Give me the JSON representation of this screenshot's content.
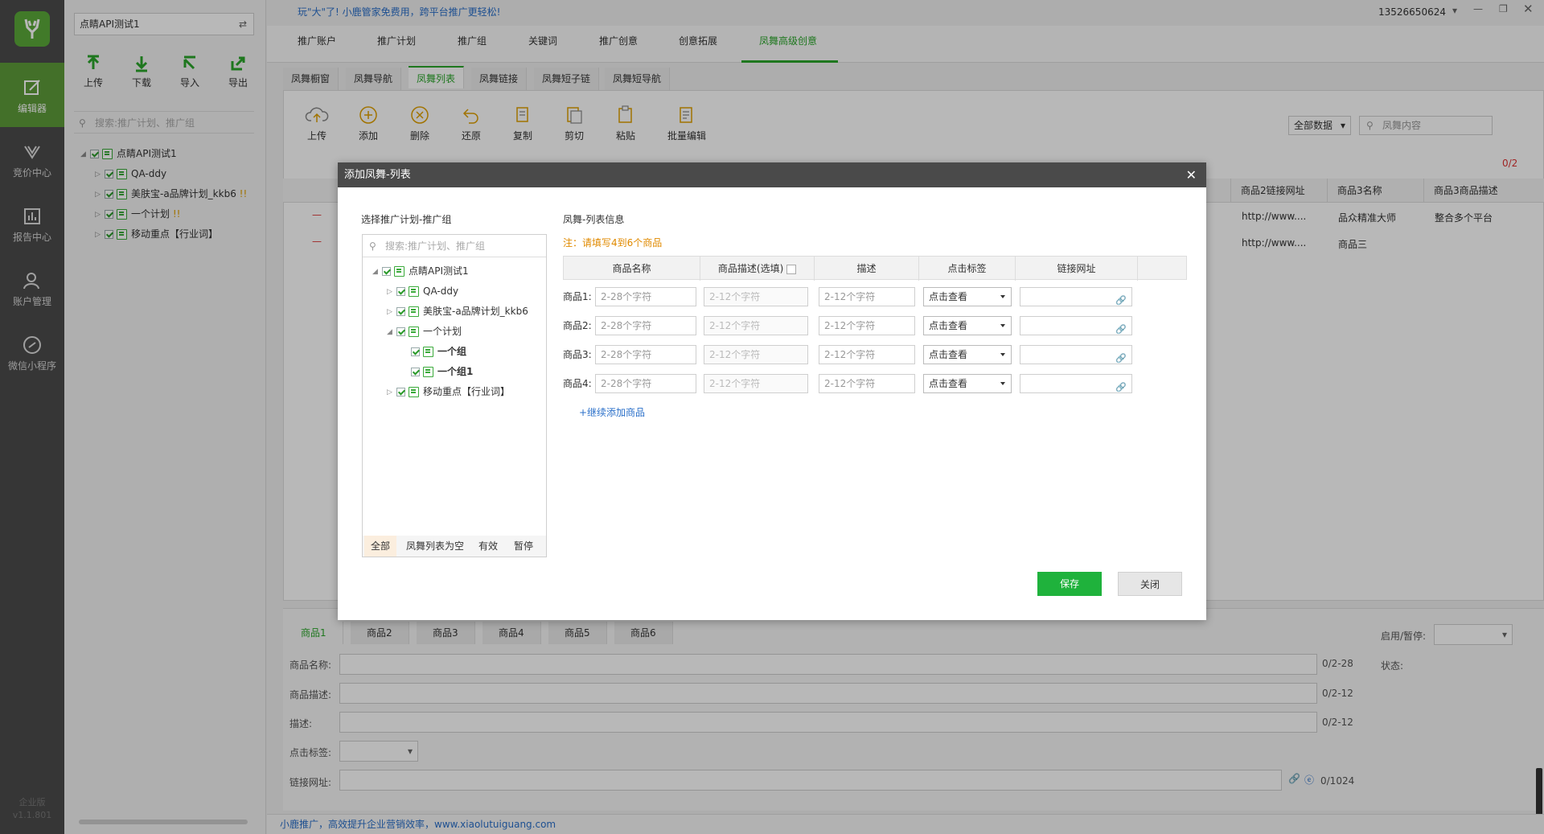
{
  "app": {
    "logo_text": "",
    "edition": "企业版",
    "version": "v1.1.801",
    "user": "13526650624"
  },
  "left_nav": [
    {
      "label": "编辑器",
      "icon": "edit-icon",
      "active": true
    },
    {
      "label": "竞价中心",
      "icon": "bid-icon"
    },
    {
      "label": "报告中心",
      "icon": "report-icon"
    },
    {
      "label": "账户管理",
      "icon": "user-icon"
    },
    {
      "label": "微信小程序",
      "icon": "mini-program-icon"
    }
  ],
  "panel": {
    "account_select": "点睛API测试1",
    "toolbar": [
      "上传",
      "下载",
      "导入",
      "导出"
    ],
    "search_placeholder": "搜索:推广计划、推广组",
    "tree": [
      {
        "label": "点睛API测试1",
        "level": 0
      },
      {
        "label": "QA-ddy",
        "level": 1
      },
      {
        "label": "美肤宝-a品牌计划_kkb6",
        "level": 1,
        "flag": "!!"
      },
      {
        "label": "一个计划",
        "level": 1,
        "flag": "!!"
      },
      {
        "label": "移动重点【行业词】",
        "level": 1
      }
    ]
  },
  "header": {
    "promo": "玩\"大\"了! 小鹿管家免费用，跨平台推广更轻松!",
    "tabs": [
      "推广账户",
      "推广计划",
      "推广组",
      "关键词",
      "推广创意",
      "创意拓展",
      "凤舞高级创意"
    ],
    "active_tab": "凤舞高级创意",
    "subtabs": [
      "凤舞橱窗",
      "凤舞导航",
      "凤舞列表",
      "凤舞链接",
      "凤舞短子链",
      "凤舞短导航"
    ],
    "active_subtab": "凤舞列表"
  },
  "actions": [
    "上传",
    "添加",
    "删除",
    "还原",
    "复制",
    "剪切",
    "粘贴",
    "批量编辑"
  ],
  "filter": {
    "all_data": "全部数据",
    "search_placeholder": "凤舞内容",
    "count": "0/2"
  },
  "grid": {
    "headers": [
      "商品2链接网址",
      "商品3名称",
      "商品3商品描述"
    ],
    "rows": [
      {
        "mark": "—",
        "c1": "http://www....",
        "c2": "品众精准大师",
        "c3": "整合多个平台"
      },
      {
        "mark": "—",
        "c1": "http://www....",
        "c2": "商品三",
        "c3": ""
      }
    ]
  },
  "dialog": {
    "title": "添加凤舞-列表",
    "left_title": "选择推广计划-推广组",
    "left_search_placeholder": "搜索:推广计划、推广组",
    "tree": [
      {
        "label": "点睛API测试1",
        "level": 0,
        "expanded": true
      },
      {
        "label": "QA-ddy",
        "level": 1
      },
      {
        "label": "美肤宝-a品牌计划_kkb6",
        "level": 1
      },
      {
        "label": "一个计划",
        "level": 1,
        "expanded": true
      },
      {
        "label": "一个组",
        "level": 2
      },
      {
        "label": "一个组1",
        "level": 2
      },
      {
        "label": "移动重点【行业词】",
        "level": 1
      }
    ],
    "filter_tabs": [
      "全部",
      "凤舞列表为空",
      "有效",
      "暂停"
    ],
    "right_title": "凤舞-列表信息",
    "note": "注：请填写4到6个商品",
    "columns": [
      "商品名称",
      "商品描述(选填)",
      "描述",
      "点击标签",
      "链接网址"
    ],
    "rows": [
      {
        "label": "商品1:",
        "name_ph": "2-28个字符",
        "desc_ph": "2-12个字符",
        "d_ph": "2-12个字符",
        "tag": "点击查看"
      },
      {
        "label": "商品2:",
        "name_ph": "2-28个字符",
        "desc_ph": "2-12个字符",
        "d_ph": "2-12个字符",
        "tag": "点击查看"
      },
      {
        "label": "商品3:",
        "name_ph": "2-28个字符",
        "desc_ph": "2-12个字符",
        "d_ph": "2-12个字符",
        "tag": "点击查看"
      },
      {
        "label": "商品4:",
        "name_ph": "2-28个字符",
        "desc_ph": "2-12个字符",
        "d_ph": "2-12个字符",
        "tag": "点击查看"
      }
    ],
    "add_more": "+继续添加商品",
    "save": "保存",
    "close": "关闭"
  },
  "bottom": {
    "tabs": [
      "商品1",
      "商品2",
      "商品3",
      "商品4",
      "商品5",
      "商品6"
    ],
    "fields": [
      {
        "label": "商品名称:",
        "count": "0/2-28"
      },
      {
        "label": "商品描述:",
        "count": "0/2-12"
      },
      {
        "label": "描述:",
        "count": "0/2-12"
      },
      {
        "label": "点击标签:",
        "count": ""
      },
      {
        "label": "链接网址:",
        "count": "0/1024"
      }
    ],
    "status_label": "启用/暂停:",
    "state_label": "状态:"
  },
  "footer": "小鹿推广，高效提升企业营销效率，www.xiaolutuiguang.com",
  "colors": {
    "brand_green": "#2aa52a",
    "nav_bg": "#4c4c4c",
    "nav_active": "#5d9c3a",
    "note_orange": "#e08a00"
  }
}
